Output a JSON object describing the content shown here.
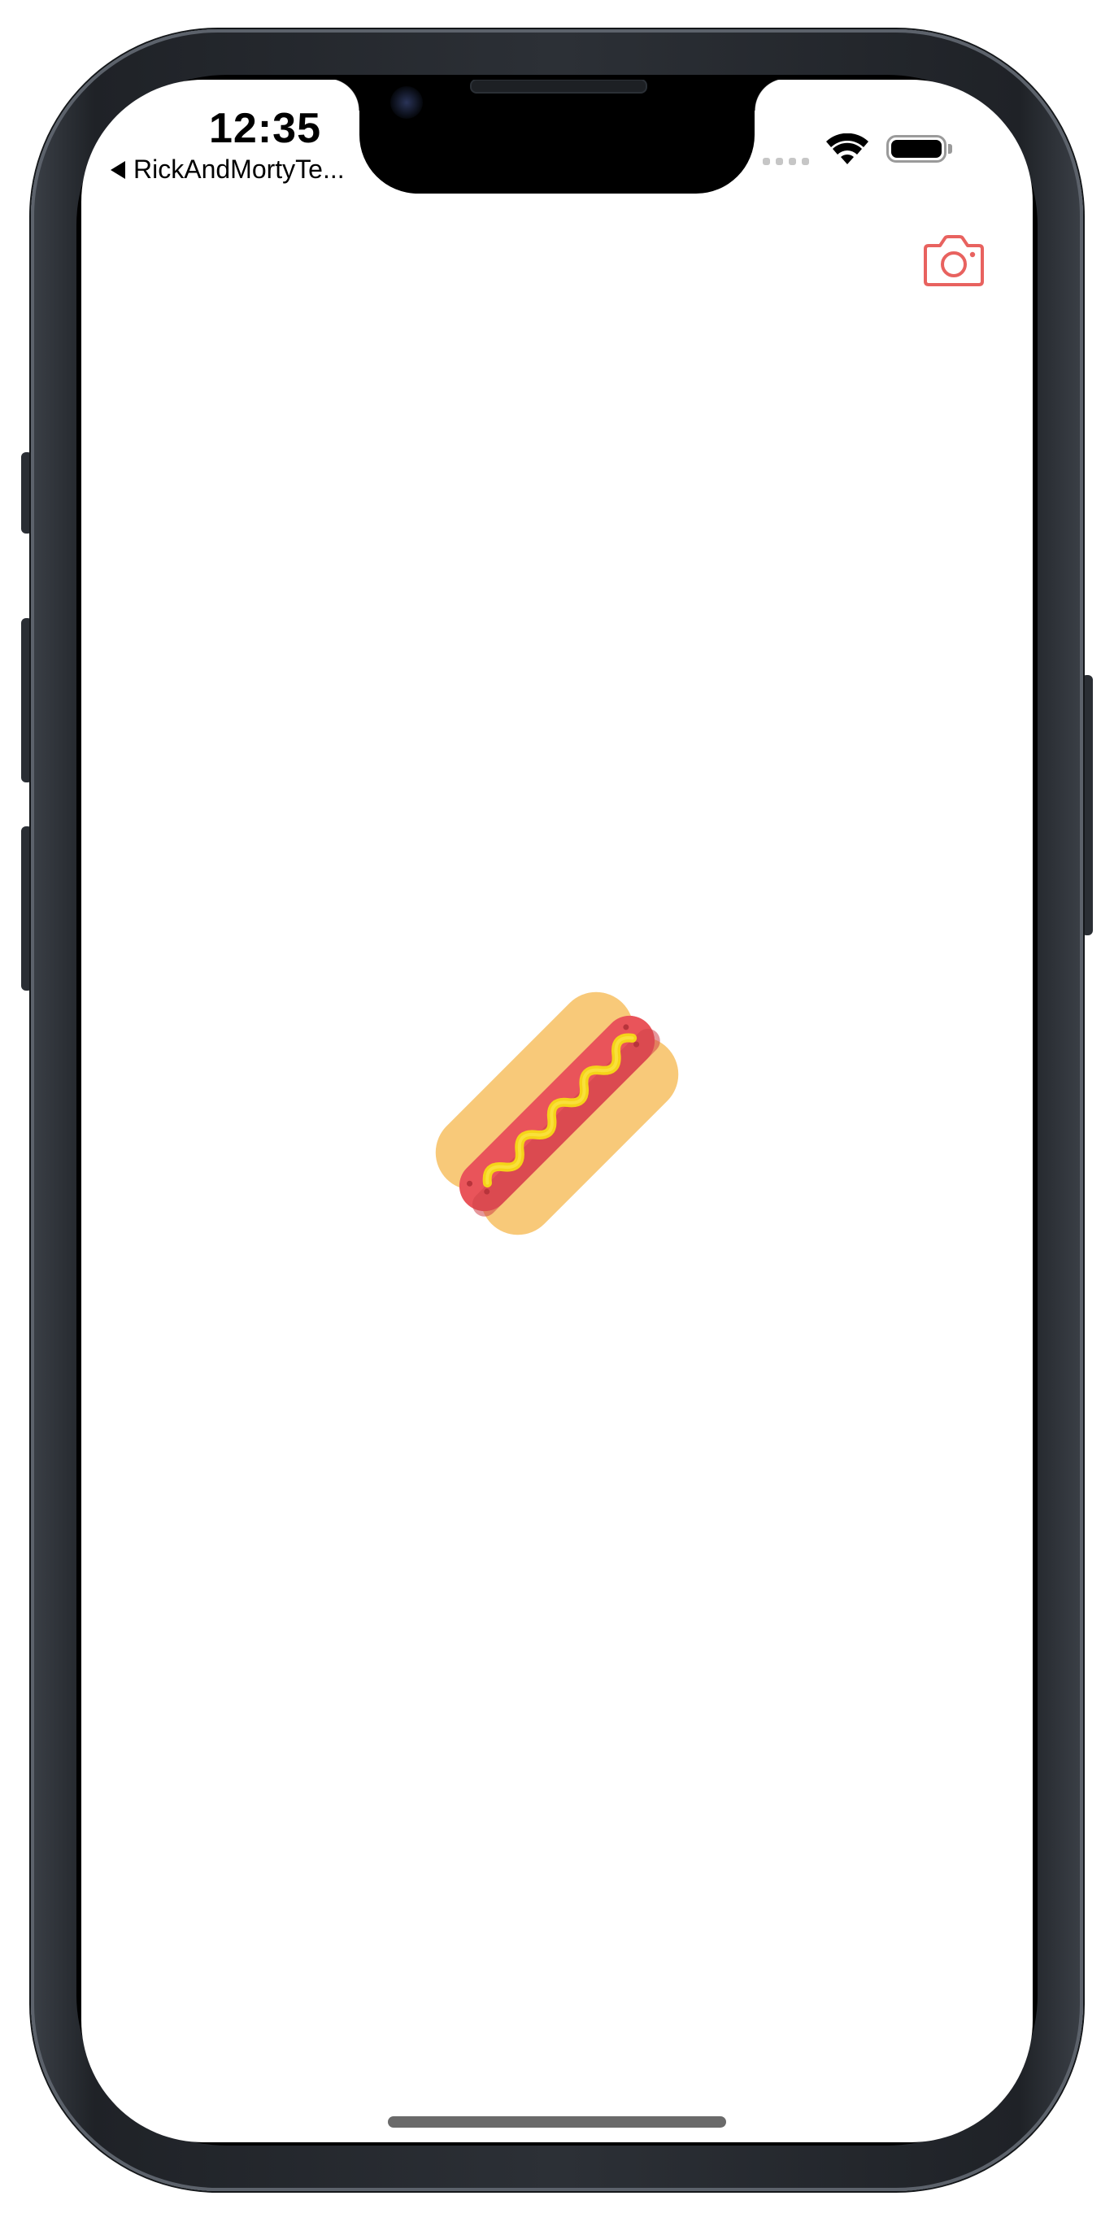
{
  "status_bar": {
    "time": "12:35",
    "back_label": "RickAndMortyTe...",
    "signal_bars": 4,
    "wifi_icon": "wifi-icon",
    "battery_icon": "battery-icon"
  },
  "toolbar": {
    "camera_icon": "camera-icon",
    "accent_color": "#e8625f"
  },
  "content": {
    "image_icon": "hotdog-icon"
  },
  "colors": {
    "bun": "#f8c979",
    "bun_shadow": "#e9b86a",
    "sausage": "#e9545a",
    "sausage_dark": "#cf4249",
    "mustard": "#f5d419",
    "frame": "#2a2e34",
    "home_indicator": "#6a6a6a"
  }
}
